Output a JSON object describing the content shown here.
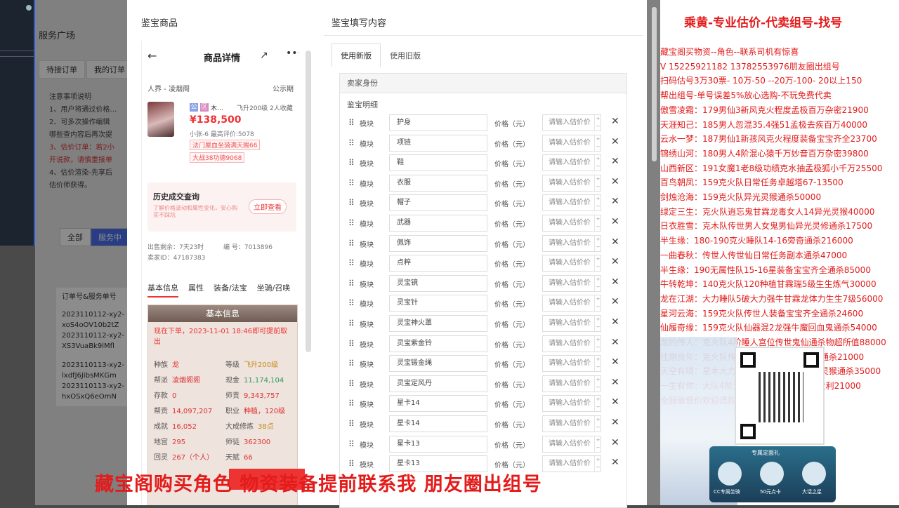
{
  "background": {
    "title": "服务广场",
    "tabs": [
      "待接订单",
      "我的订单"
    ],
    "notes_title": "注意事项说明",
    "notes": [
      "1、用户将通过价格…",
      "2、可多次操作编辑",
      "哪些查内容后再次提",
      "3、估价订单：若2小",
      "开说款，请慎重接单",
      "4、估价渲染-先享后",
      "估价师获得。"
    ],
    "filters": [
      "全部",
      "服务中"
    ],
    "table_header": "订单号&服务单号",
    "table_rows": [
      "2023110112-xy2-",
      "xoS4oOV10b2tZ",
      "2023110112-xy2-",
      "XS3VuaBk9lMfl",
      "2023110113-xy2-",
      "lxdfJ6JibsMKGm",
      "2023110113-xy2-",
      "hxOSxQ6eOmN"
    ]
  },
  "modal": {
    "left_title": "鉴宝商品",
    "right_title": "鉴宝填写内容",
    "phone": {
      "header_title": "商品详情",
      "server": "人界 - 凌烟阁",
      "server_type": "公示期",
      "tags": [
        "公",
        "区"
      ],
      "name": "木…",
      "level": "飞升200级  2人收藏",
      "price": "¥138,500",
      "meta": "小张-6  最高评价:5078",
      "chips": [
        "法门屋血坐骑满天赐66",
        "大战38功德9068"
      ],
      "history_title": "历史成交查询",
      "history_desc": "了解价格波动和属性变化，安心购买不踩坑",
      "history_btn": "立即查看",
      "publicity_left": "出售剩余：7天23时",
      "item_no": "编 号：7013896",
      "seller_id": "卖家ID：47187383",
      "subtabs": [
        "基本信息",
        "属性",
        "装备/法宝",
        "坐骑/召唤"
      ],
      "basic_title": "基本信息",
      "notice": "现在下单，2023-11-01 18:46即可提前取出",
      "fields": [
        {
          "k": "种族",
          "v": "龙",
          "k2": "等级",
          "v2": "飞升200级"
        },
        {
          "k": "帮派",
          "v": "凌烟阁阁",
          "k2": "现金",
          "v2": "11,174,104"
        },
        {
          "k": "存款",
          "v": "0",
          "k2": "师贡",
          "v2": "9,343,757"
        },
        {
          "k": "帮贡",
          "v": "14,097,207",
          "k2": "职业",
          "v2": "种植，120级"
        },
        {
          "k": "成就",
          "v": "16,052",
          "k2": "大成修炼",
          "v2": "38点"
        },
        {
          "k": "地宫",
          "v": "295",
          "k2": "师徒",
          "v2": "362300"
        },
        {
          "k": "回灵",
          "v": "267（个人）",
          "k2": "天赋",
          "v2": "66"
        }
      ]
    },
    "form": {
      "tabs": [
        "使用新版",
        "使用旧版"
      ],
      "section": "卖家身份",
      "subsection": "鉴宝明细",
      "module_label": "模块",
      "price_label": "价格（元）",
      "price_placeholder": "请输入估价价",
      "modules": [
        "护身",
        "项链",
        "鞋",
        "衣服",
        "帽子",
        "武器",
        "佩饰",
        "点粹",
        "灵宝镜",
        "灵宝针",
        "灵宝神火罩",
        "灵宝紫金铃",
        "灵宝锻金绳",
        "灵宝定风丹",
        "星卡14",
        "星卡14",
        "星卡13",
        "星卡13"
      ]
    }
  },
  "sidebar": {
    "title": "乘黄-专业估价-代卖组号-找号",
    "lines": [
      "藏宝阁买物资--角色--联系司机有惊喜",
      "V 15225921182  13782553976朋友圈出组号",
      "扫码估号3万30票- 10万-50 --20万-100- 20以上150",
      "帮出组号-单号误差5%放心选购-不玩免费代卖",
      "傲雪凌霜：179男仙3新风克火程度孟极百万杂密21900",
      "天涯知己：185男人忽混35.4强51孟极去疾百万40000",
      "云水一梦：187男仙1新孩风克火程度装备宝宝齐全23700",
      "锦绣山河：180男人4阶混心猿千万妙音百万杂密39800",
      "山西新区：191女魔1老8级功绩克水抽孟极狐小千万25500",
      "百鸟朝凤：159克火队日常任务卓越塔67-13500",
      "剑烛沧海：159克火队异光灵猴通杀50000",
      "绿定三生：克火队逍忘鬼甘霖龙毒女人14异光灵猴40000",
      "日衣胜雪：克木队传世男人女鬼男仙异光灵修通杀17500",
      "半生缘：180-190克火睡队14-16旁奇通杀216000",
      "一曲春秋：传世人传世仙日常任务副本通杀47000",
      "半生缘：190无属性队15-16星装备宝宝齐全通杀85000",
      "牛转乾坤：140克火队120种植甘霖瑞5级生生炼气30000",
      "龙在江湖：大力睡队5破大力强牛甘霖龙体力生生7级56000",
      "星河云海：159克火队传世人装备宝宝齐全通杀24600",
      "仙履奇缘：159克火队仙器混2龙强牛魔回血鬼通杀54000",
      "龙的传人：克火队4阶睡人宫位传世鬼仙通杀物超所值88000",
      "佳期良年：克火队传世仙人灵仙队传世男人通杀21000",
      "天空有晴：星木大力传世人强牛甘霖龙异光灵猴通杀35000",
      "一生有你：大队4阶双人装备宝宝齐全千里盈利21000",
      "全服最低价欢迎选购，管管加好友"
    ],
    "app_card_title": "专属定面礼",
    "app_icons": [
      "CC专属坐骑",
      "50元点卡",
      "大话之星"
    ]
  },
  "banner": "藏宝阁购买角色 物资装备提前联系我    朋友圈出组号",
  "colors": {
    "accent_red": "#e31b1b",
    "primary_blue": "#4a6ff0"
  }
}
